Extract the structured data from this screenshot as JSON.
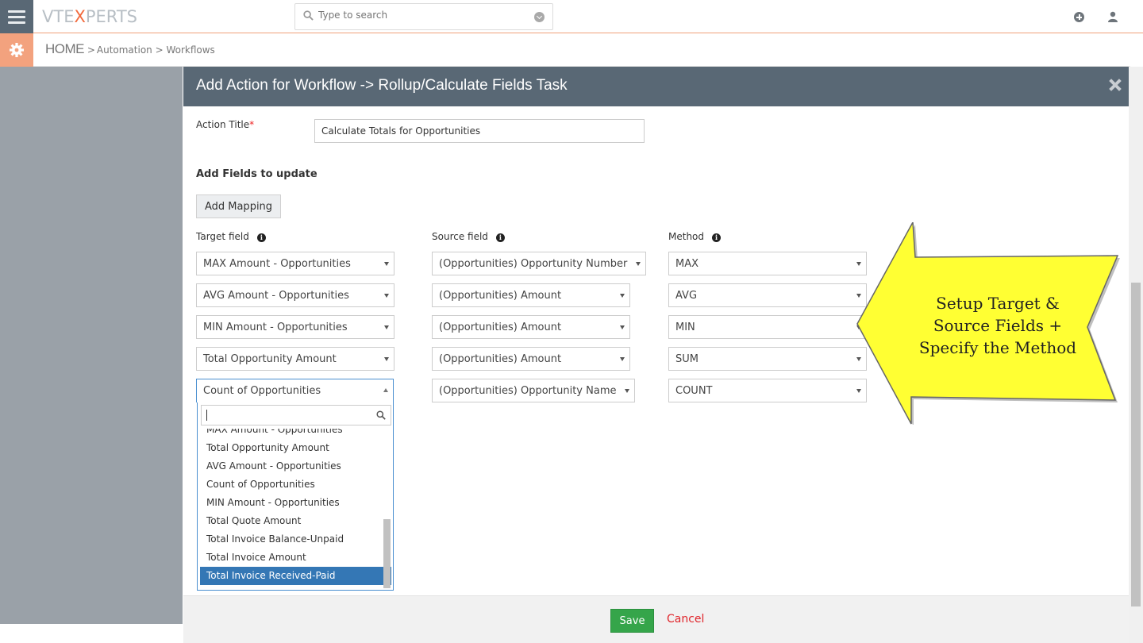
{
  "topbar": {
    "logo_pre": "VTE",
    "logo_x": "X",
    "logo_post": "PERTS",
    "search_placeholder": "Type to search"
  },
  "breadcrumb": {
    "home": "HOME",
    "sep1": " >",
    "automation": "Automation",
    "sep2": " > ",
    "workflows": "Workflows"
  },
  "modal": {
    "title": "Add Action for Workflow -> Rollup/Calculate Fields Task",
    "action_title_label": "Action Title",
    "required_mark": "*",
    "action_title_value": "Calculate Totals for Opportunities",
    "fields_heading": "Add Fields to update",
    "add_mapping_label": "Add Mapping",
    "col_target": "Target field",
    "col_source": "Source field",
    "col_method": "Method",
    "info_glyph": "i",
    "rows": [
      {
        "target": "MAX Amount - Opportunities",
        "source": "(Opportunities) Opportunity Number",
        "method": "MAX"
      },
      {
        "target": "AVG Amount - Opportunities",
        "source": "(Opportunities) Amount",
        "method": "AVG"
      },
      {
        "target": "MIN Amount - Opportunities",
        "source": "(Opportunities) Amount",
        "method": "MIN"
      },
      {
        "target": "Total Opportunity Amount",
        "source": "(Opportunities) Amount",
        "method": "SUM"
      },
      {
        "target": "Count of Opportunities",
        "source": "(Opportunities) Opportunity Name",
        "method": "COUNT"
      }
    ],
    "dropdown_options": [
      "MAX Amount - Opportunities",
      "Total Opportunity Amount",
      "AVG Amount - Opportunities",
      "Count of Opportunities",
      "MIN Amount - Opportunities",
      "Total Quote Amount",
      "Total Invoice Balance-Unpaid",
      "Total Invoice Amount",
      "Total Invoice Received-Paid"
    ],
    "dropdown_highlighted": "Total Invoice Received-Paid",
    "save_label": "Save",
    "cancel_label": "Cancel"
  },
  "callout": {
    "line1": "Setup Target &",
    "line2": "Source Fields +",
    "line3": "Specify the Method",
    "fill": "#ffff33"
  },
  "colors": {
    "header_bg": "#596875",
    "accent": "#f26a3d",
    "save_green": "#35a54a",
    "cancel_red": "#e0252b",
    "selected_blue": "#3477b5"
  }
}
